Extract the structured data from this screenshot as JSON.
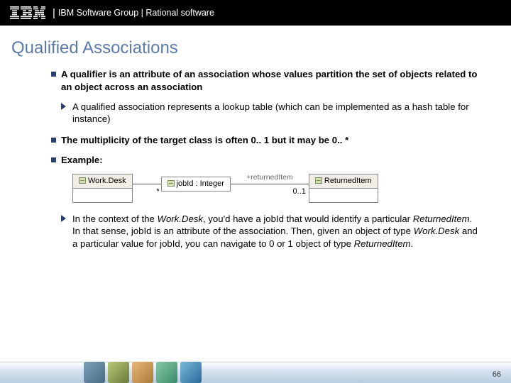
{
  "header": {
    "group_text": "IBM Software Group | Rational software"
  },
  "title": "Qualified Associations",
  "bullets": {
    "b1a": "A qualifier is an attribute of an association whose values partition the set of objects related to an object across an association",
    "b2a": "A qualified association represents a lookup table (which can be implemented as a hash table for instance)",
    "b1b": "The multiplicity of the target class is often 0.. 1 but it may be 0.. *",
    "b1c": "Example:"
  },
  "diagram": {
    "left_class": "Work.Desk",
    "qualifier": "jobId : Integer",
    "mult_left": "*",
    "assoc_name": "+returnedItem",
    "mult_right": "0..1",
    "right_class": "ReturnedItem"
  },
  "explain": {
    "pre": "In the context of the ",
    "work_desk": "Work.Desk",
    "p1": ", you'd have a jobId that would identify a particular ",
    "returned_item": "ReturnedItem",
    "p2": ". In that sense, jobId is an attribute of the association. Then, given an object of type ",
    "work_desk2": "Work.Desk",
    "p3": " and a particular value for jobId, you can navigate to 0 or 1 object of type ",
    "returned_item2": "ReturnedItem",
    "p4": "."
  },
  "page_number": "66"
}
